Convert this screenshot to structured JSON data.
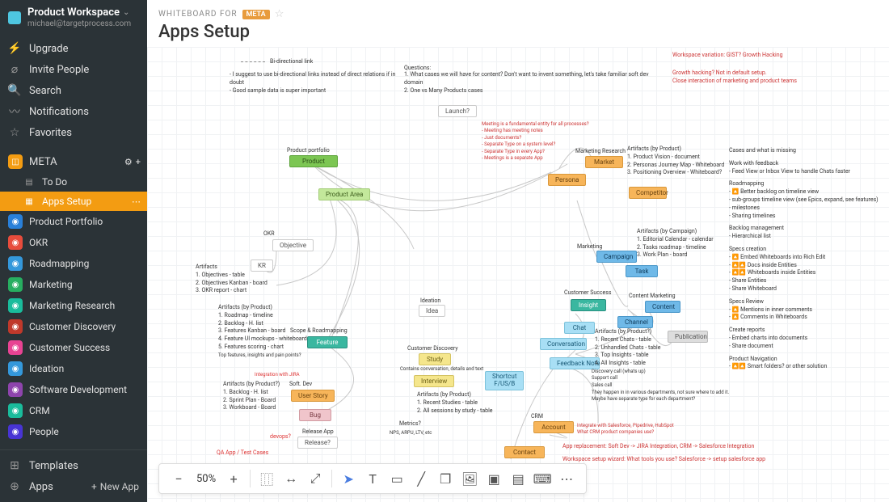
{
  "workspace": {
    "title": "Product Workspace",
    "email": "michael@targetprocess.com"
  },
  "nav": {
    "upgrade": "Upgrade",
    "invite": "Invite People",
    "search": "Search",
    "notifications": "Notifications",
    "favorites": "Favorites",
    "templates": "Templates",
    "apps": "Apps",
    "new_app": "New App"
  },
  "meta_section": {
    "label": "META",
    "todo": "To Do",
    "apps_setup": "Apps Setup"
  },
  "apps": [
    {
      "label": "Product Portfolio",
      "color": "ic-blue"
    },
    {
      "label": "OKR",
      "color": "ic-red"
    },
    {
      "label": "Roadmapping",
      "color": "ic-cyan"
    },
    {
      "label": "Marketing",
      "color": "ic-green"
    },
    {
      "label": "Marketing Research",
      "color": "ic-teal"
    },
    {
      "label": "Customer Discovery",
      "color": "ic-red2"
    },
    {
      "label": "Customer Success",
      "color": "ic-pink"
    },
    {
      "label": "Ideation",
      "color": "ic-cyan"
    },
    {
      "label": "Software Development",
      "color": "ic-purple"
    },
    {
      "label": "CRM",
      "color": "ic-teal"
    },
    {
      "label": "People",
      "color": "ic-indigo"
    }
  ],
  "header": {
    "breadcrumb_prefix": "WHITEBOARD FOR",
    "breadcrumb_app": "META",
    "title": "Apps Setup"
  },
  "toolbar": {
    "zoom": "50%"
  },
  "canvas": {
    "legend": "Bi-directional link",
    "suggestions": "- I suggest to use bi-directional links instead of direct relations if in doubt\n- Good sample data is super important",
    "questions_title": "Questions:",
    "questions": "1. What cases we will have for content? Don't want to invent something, let's take familiar soft dev domain\n2. One vs Many Products cases",
    "variation": "Workspace variation: GIST? Growth Hacking",
    "growth_hacking": "Growth hacking? Not in default setup.\nClose interaction of marketing and product teams",
    "launch": "Launch?",
    "meeting_notes": "Meeting is a fundamental entity for all processes?\n- Meeting has meeting notes\n- Just documents?\n- Separate Type on a system level?\n- Separate Type in every App?\n- Meetings is a separate App",
    "portfolio_label": "Product portfolio",
    "product": "Product",
    "product_area": "Product Area",
    "okr_label": "OKR",
    "objective": "Objective",
    "kr": "KR",
    "artifacts_okr": "Artifacts\n1. Objectives - table\n2. Objectives Kanban - board\n3. OKR report - chart",
    "artifacts_roadmap": "Artifacts (by Product)\n1. Roadmap - timeline\n2. Backlog - H. list\n3. Features Kanban - board\n4. Feature UI mockups - whiteboard\n5. Features scoring - chart",
    "top_features": "Top features, insights and pain points?",
    "scope_roadmap": "Scope & Roadmapping",
    "feature": "Feature",
    "integration_jira": "Integration with JIRA",
    "artifacts_dev": "Artifacts (by Product?)\n1. Backlog - H. list\n2. Sprint Plan - Board\n3. Workboard - Board",
    "soft_dev": "Soft. Dev",
    "user_story": "User Story",
    "bug": "Bug",
    "devops": "devops?",
    "release_app": "Release App",
    "release": "Release?",
    "qa": "QA App / Test Cases",
    "ideation": "Ideation",
    "idea": "Idea",
    "discovery": "Customer Discovery",
    "study": "Study",
    "interview": "Interview",
    "contains_conv": "Contains conversation, details and text",
    "artifacts_discovery": "Artifacts (by Product)\n1. Recent Studies - table\n2. All sessions by study - table",
    "metrics": "Metrics?",
    "nps": "NPS, ARPU, LTV, etc",
    "shortcut": "Shortcut\nF/US/B",
    "marketing_research": "Marketing Research",
    "market": "Market",
    "persona": "Persona",
    "competitor": "Competitor",
    "artifacts_mr": "Artifacts (by Product)\n1. Product Vision - document\n2. Personas Journey Map - Whiteboard\n3. Positioning Overview - Whiteboard?",
    "marketing": "Marketing",
    "campaign": "Campaign",
    "task": "Task",
    "artifacts_marketing": "Artifacts (by Campaign)\n1. Editorial Calendar - calendar\n2. Tasks roadmap - timeline\n3. Work Plan - board",
    "customer_success": "Customer Success",
    "insight": "Insight",
    "chat": "Chat",
    "conversation": "Conversation",
    "feedback_note": "Feedback Note",
    "content_marketing": "Content Marketing",
    "content": "Content",
    "channel": "Channel",
    "publication": "Publication",
    "artifacts_insight": "Artifacts (by Product?)\n1. Recent Chats - table\n2. Unhandled Chats - table\n3. Top Insights - table\n4. All Insights - table",
    "discovery_call": "Discovery call (whats up)\nSupport call\nSales call",
    "happen_notes": "They happen in in various departments, not sure where to add it.\nMaybe have separate type for each department?",
    "crm": "CRM",
    "account": "Account",
    "contact": "Contact",
    "integrate_sf": "Integrate with Salesforce, Pipedrive, HubSpot\nWhat CRM product companies use?",
    "app_replacement": "App replacement: Soft Dev -> JIRA Integration, CRM -> Salesforce Integration",
    "wizard": "Workspace setup wizard: What tools you use? Salesforce -> setup salesforce app",
    "right_notes": {
      "l1_title": "Cases and what is missing",
      "l2_title": "Work with feedback",
      "l2_body": "- Feed View or Inbox View to handle Chats faster",
      "l3_title": "Roadmapping",
      "l3_body": "- 🔼 Better backlog on timeline view\n- sub-groups timeline view (see Epics, expand, see features)\n- milestones\n- Sharing timelines",
      "l4_title": "Backlog management",
      "l4_body": "- Hierarchical list",
      "l5_title": "Specs creation",
      "l5_body": "- 🔼 Embed Whiteboards into Rich Edit\n- 🔼🔼 Docs inside Entities\n- 🔼🔼 Whiteboards inside Entities\n- Share Entities\n- Share Whiteboard",
      "l6_title": "Specs Review",
      "l6_body": "- 🔼 Mentions in inner comments\n- 🔼 Comments in Whiteboards",
      "l7_title": "Create reports",
      "l7_body": "- Embed charts into documents\n- Share document",
      "l8_title": "Product Navigation",
      "l8_body": "- 🔼🔼 Smart folders? or other solution"
    }
  }
}
